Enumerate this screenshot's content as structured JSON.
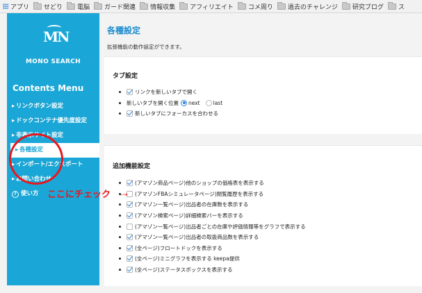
{
  "bookmarks": {
    "apps_label": "アプリ",
    "items": [
      "せどり",
      "電脳",
      "ガード関連",
      "情報収集",
      "アフィリエイト",
      "コメ周り",
      "過去のチャレンジ",
      "研究ブログ",
      "ス"
    ]
  },
  "sidebar": {
    "logo_mark": "MN",
    "logo_text": "MONO SEARCH",
    "menu_title": "Contents Menu",
    "items": [
      {
        "label": "リンクボタン設定"
      },
      {
        "label": "ドックコンテナ優先度設定"
      },
      {
        "label": "非表示サイト設定"
      },
      {
        "label": "各種設定"
      },
      {
        "label": "インポート/エクスポート"
      },
      {
        "label": "お問い合わせ"
      },
      {
        "label": "使い方"
      }
    ],
    "active_index": 3
  },
  "main": {
    "title": "各種設定",
    "description": "拡張機能の動作設定ができます。",
    "tab_panel": {
      "title": "タブ設定",
      "open_new_tab": {
        "label": "リンクを新しいタブで開く",
        "checked": true
      },
      "position": {
        "label": "新しいタブを開く位置",
        "options": [
          "next",
          "last"
        ],
        "selected": "next"
      },
      "focus_new_tab": {
        "label": "新しいタブにフォーカスを合わせる",
        "checked": true
      }
    },
    "addon_panel": {
      "title": "追加機能設定",
      "options": [
        {
          "label": "(アマゾン商品ページ)他のショップの価格表を表示する",
          "checked": true
        },
        {
          "label": "(アマゾンFBAシミュレータページ)閲覧履歴を表示する",
          "checked": false
        },
        {
          "label": "(アマゾン一覧ページ)出品者の在庫数を表示する",
          "checked": true
        },
        {
          "label": "(アマゾン検索ページ)詳細検索バーを表示する",
          "checked": true
        },
        {
          "label": "(アマゾン一覧ページ)出品者ごとの在庫や評価情報等をグラフで表示する",
          "checked": false
        },
        {
          "label": "(アマゾン一覧ページ)出品者の取扱商品数を表示する",
          "checked": true
        },
        {
          "label": "(全ページ)フロートドックを表示する",
          "checked": true
        },
        {
          "label": "(全ページ)ミニグラフを表示する keepa提供",
          "checked": true
        },
        {
          "label": "(全ページ)ステータスボックスを表示する",
          "checked": true
        }
      ]
    }
  },
  "annotation": {
    "text": "ここにチェック",
    "arrow": "-→",
    "color": "#e8161c"
  },
  "colors": {
    "sidebar": "#1aa6d6",
    "title": "#1a8ccf",
    "check": "#2c7fe0"
  }
}
